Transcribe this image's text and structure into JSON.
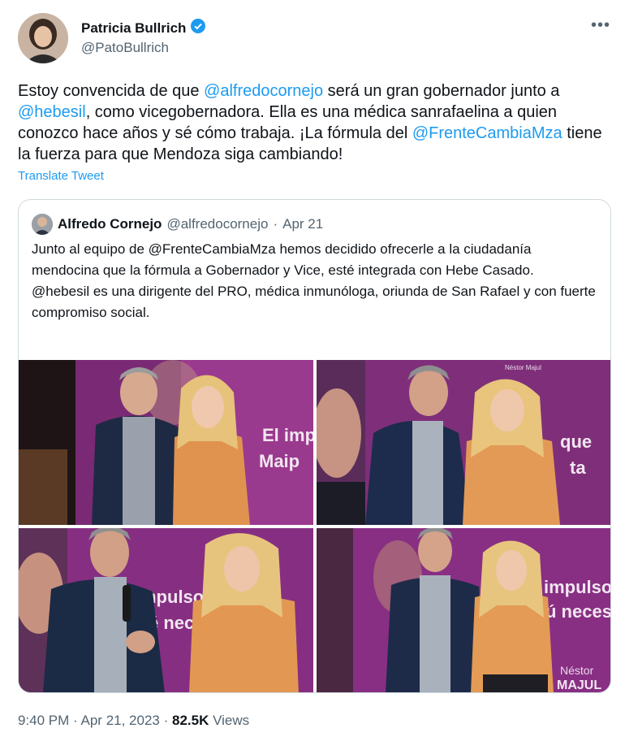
{
  "author": {
    "name": "Patricia Bullrich",
    "handle": "@PatoBullrich"
  },
  "tweet": {
    "t1": "Estoy convencida de que ",
    "m1": "@alfredocornejo",
    "t2": " será un gran gobernador junto a ",
    "m2": "@hebesil",
    "t3": ", como vicegobernadora. Ella es una médica sanrafaelina a quien conozco hace años y sé cómo trabaja. ¡La fórmula del ",
    "m3": "@FrenteCambiaMza",
    "t4": " tiene la fuerza para que Mendoza siga cambiando!",
    "translate": "Translate Tweet"
  },
  "quote": {
    "name": "Alfredo Cornejo",
    "handle": "@alfredocornejo",
    "sep": "·",
    "date": "Apr 21",
    "p1": "Junto al equipo de @FrenteCambiaMza hemos decidido ofrecerle a la ciudadanía mendocina que la fórmula a Gobernador y Vice, esté integrada con Hebe Casado.",
    "p2": "@hebesil es una dirigente del PRO, médica inmunóloga, oriunda de San Rafael y con fuerte compromiso social."
  },
  "photo_text": {
    "p1_line1": "El imp",
    "p1_line2": "Maip",
    "p2_line1": "que",
    "p2_line2": "ta",
    "p2_top": "Néstor Majul",
    "p3_line1": "mpulso",
    "p3_line2": "é necesi",
    "p4_line1": "impulso qu",
    "p4_line2": "ú necesi",
    "p4_sig1": "Néstor",
    "p4_sig2": "MAJUL"
  },
  "footer": {
    "time": "9:40 PM",
    "sep": "·",
    "date": "Apr 21, 2023",
    "views_count": "82.5K",
    "views_label": "Views"
  },
  "colors": {
    "accent": "#1d9bf0",
    "verified": "#1d9bf0",
    "banner_purple": "#8e2f86"
  },
  "icons": [
    "verified-badge-icon",
    "more-icon"
  ]
}
